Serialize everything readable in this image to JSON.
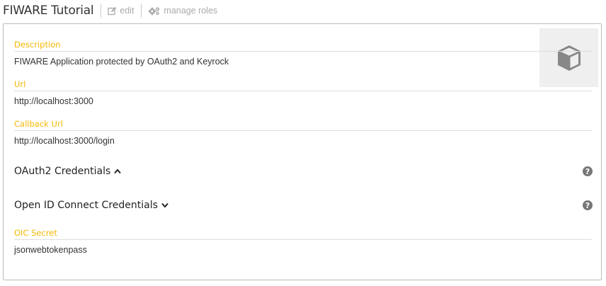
{
  "header": {
    "title": "FIWARE Tutorial",
    "edit_label": "edit",
    "manage_roles_label": "manage roles"
  },
  "application": {
    "description_label": "Description",
    "description_value": "FIWARE Application protected by OAuth2 and Keyrock",
    "url_label": "Url",
    "url_value": "http://localhost:3000",
    "callback_label": "Callback Url",
    "callback_value": "http://localhost:3000/login"
  },
  "credentials": {
    "oauth2_label": "OAuth2 Credentials",
    "oauth2_state": "expanded",
    "oidc_label": "Open ID Connect Credentials",
    "oidc_state": "collapsed",
    "oic_secret_label": "OIC Secret",
    "oic_secret_value": "jsonwebtokenpass"
  },
  "icons": {
    "edit": "edit-icon",
    "manage_roles": "gears-icon",
    "app_image": "cube-icon",
    "help": "question-circle-icon",
    "expanded": "chevron-up-icon",
    "collapsed": "chevron-down-icon"
  },
  "colors": {
    "label_accent": "#f5b800",
    "header_links": "#aaaaaa",
    "help_icon": "#777777"
  }
}
